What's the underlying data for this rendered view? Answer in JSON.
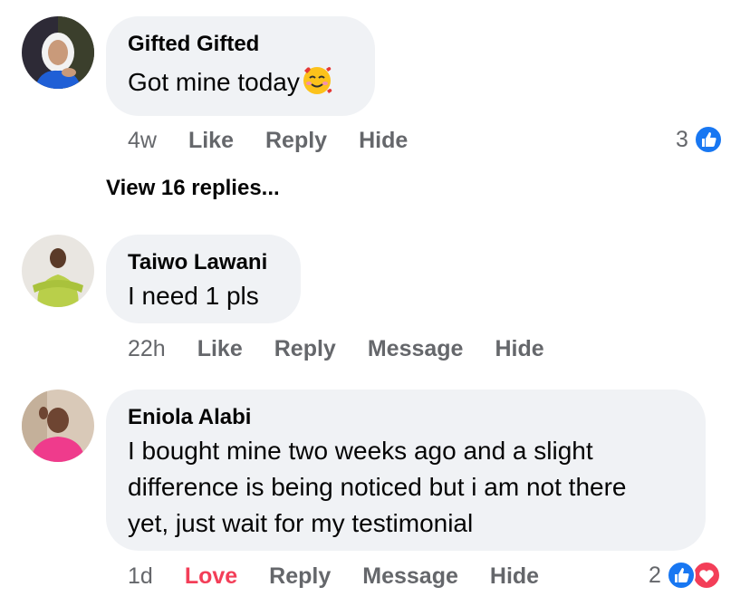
{
  "comments": [
    {
      "author": "Gifted Gifted",
      "text": "Got mine today",
      "emoji": "smiling-face-with-hearts",
      "time": "4w",
      "actions": [
        "Like",
        "Reply",
        "Hide"
      ],
      "reaction_count": "3",
      "reactions": [
        "like-icon"
      ]
    },
    {
      "author": "Taiwo Lawani",
      "text": "I need 1 pls",
      "time": "22h",
      "actions": [
        "Like",
        "Reply",
        "Message",
        "Hide"
      ]
    },
    {
      "author": "Eniola Alabi",
      "text_lines": [
        "I bought mine two weeks ago and a slight",
        "difference is being noticed but i am not there",
        "yet, just wait for my testimonial"
      ],
      "time": "1d",
      "reacted": "Love",
      "actions": [
        "Reply",
        "Message",
        "Hide"
      ],
      "reaction_count": "2",
      "reactions": [
        "like-icon",
        "love-icon"
      ]
    }
  ],
  "view_replies": "View 16 replies...",
  "colors": {
    "bubble": "#f0f2f5",
    "meta": "#65676b",
    "like_blue": "#1877f2",
    "love_red": "#f33e58"
  }
}
